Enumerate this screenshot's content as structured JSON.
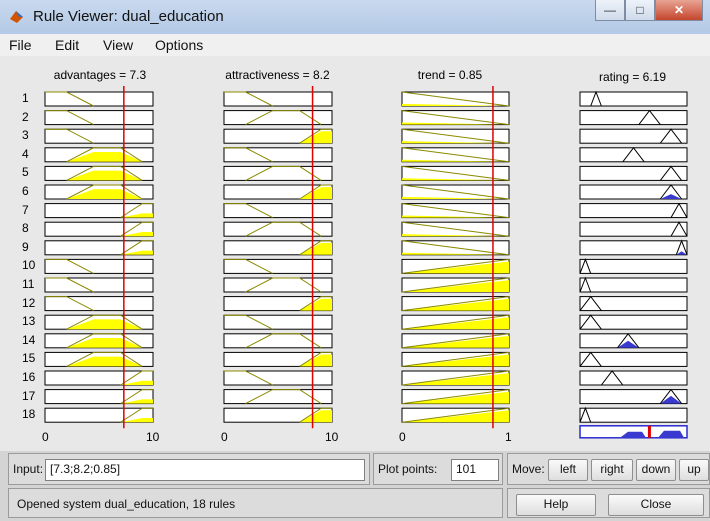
{
  "window": {
    "title": "Rule Viewer: dual_education"
  },
  "menu": [
    "File",
    "Edit",
    "View",
    "Options"
  ],
  "inputs": [
    {
      "title": "advantages = 7.3",
      "value": 7.3,
      "range": [
        0,
        10
      ],
      "tick_min": "0",
      "tick_max": "10"
    },
    {
      "title": "attractiveness = 8.2",
      "value": 8.2,
      "range": [
        0,
        10
      ],
      "tick_min": "0",
      "tick_max": "10"
    },
    {
      "title": "trend = 0.85",
      "value": 0.85,
      "range": [
        0,
        1
      ],
      "tick_min": "0",
      "tick_max": "1"
    }
  ],
  "output": {
    "title": "rating = 6.19",
    "value": 6.19
  },
  "rules": [
    "1",
    "2",
    "3",
    "4",
    "5",
    "6",
    "7",
    "8",
    "9",
    "10",
    "11",
    "12",
    "13",
    "14",
    "15",
    "16",
    "17",
    "18"
  ],
  "colors": {
    "antecedent_fill": "#ffff00",
    "consequent_fill": "#3a3ad0",
    "indicator": "#e00000",
    "mf_line": "#8a8a00"
  },
  "controls": {
    "input_label": "Input:",
    "input_value": "[7.3;8.2;0.85]",
    "plot_points_label": "Plot points:",
    "plot_points_value": "101",
    "move_label": "Move:",
    "left": "left",
    "right": "right",
    "down": "down",
    "up": "up",
    "status": "Opened system dual_education, 18 rules",
    "help": "Help",
    "close": "Close"
  }
}
